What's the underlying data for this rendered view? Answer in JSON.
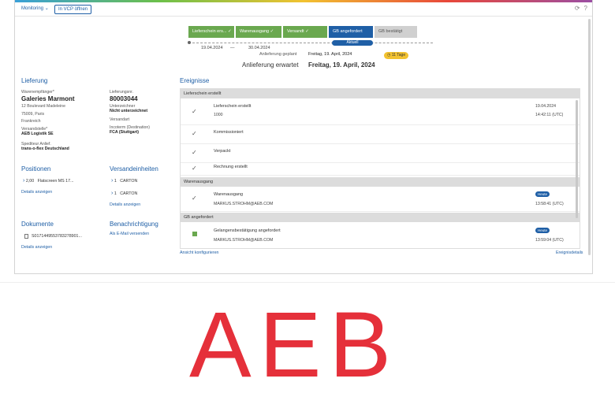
{
  "topbar": {
    "monitoring": "Monitoring",
    "vcp_button": "In VCP öffnen"
  },
  "progress": {
    "steps": [
      "Lieferschein ers...",
      "Warenausgang",
      "Versandt",
      "GB angefordert",
      "GB bestätigt"
    ],
    "current_label": "Aktuell",
    "date_start": "19.04.2024",
    "dash": "—",
    "date_end": "30.04.2024"
  },
  "delivery": {
    "planned_label": "Anlieferung geplant",
    "planned_value": "Freitag, 19. April, 2024",
    "expected_label": "Anlieferung erwartet",
    "expected_value": "Freitag, 19. April, 2024",
    "days_badge": "11 Tage"
  },
  "lieferung": {
    "title": "Lieferung",
    "recipient_label": "Warenempfänger*",
    "recipient_name": "Galeries Marmont",
    "address1": "12 Boulevard Madeleine",
    "address2": "75009, Paris",
    "address3": "Frankreich",
    "shipping_point_label": "Versandstelle*",
    "shipping_point": "AEB Logistik SE",
    "forwarder_label": "Spediteur Anlief.",
    "forwarder": "trans-o-flex Deutschland",
    "delivery_no_label": "Lieferungsnr.",
    "delivery_no": "80003044",
    "signer_label": "Unterzeichner",
    "signer": "Nicht unterzeichnet",
    "shipping_type_label": "Versandart",
    "incoterm_label": "Incoterm (Destination)",
    "incoterm": "FCA (Stuttgart)"
  },
  "positionen": {
    "title": "Positionen",
    "qty": "2,00",
    "item": "Flatscreen MS 17...",
    "link": "Details anzeigen"
  },
  "versandeinheiten": {
    "title": "Versandeinheiten",
    "units": [
      {
        "qty": "1",
        "type": "CARTON"
      },
      {
        "qty": "1",
        "type": "CARTON"
      }
    ],
    "link": "Details anzeigen"
  },
  "dokumente": {
    "title": "Dokumente",
    "doc": "S0171449553783278901...",
    "link": "Details anzeigen"
  },
  "benachrichtigung": {
    "title": "Benachrichtigung",
    "link": "Als E-Mail versenden"
  },
  "events": {
    "title": "Ereignisse",
    "group1": "Lieferschein erstellt",
    "e1_title": "Lieferschein erstellt",
    "e1_sub": "1000",
    "e1_date": "19.04.2024",
    "e1_time": "14:42:11 (UTC)",
    "e2_title": "Kommissioniert",
    "e3_title": "Verpackt",
    "e4_title": "Rechnung erstellt",
    "group2": "Warenausgang",
    "e5_title": "Warenausgang",
    "e5_sub": "MARKUS.STROHM@AEB.COM",
    "e5_badge": "Heute",
    "e5_time": "13:58:41 (UTC)",
    "group3": "GB angefordert",
    "e6_title": "Gelangensbestätigung angefordert",
    "e6_sub": "MARKUS.STROHM@AEB.COM",
    "e6_badge": "Heute",
    "e6_time": "13:59:04 (UTC)",
    "configure_link": "Ansicht konfigurieren",
    "details_link": "Ereignisdetails"
  },
  "logo": {
    "text": "AEB"
  }
}
